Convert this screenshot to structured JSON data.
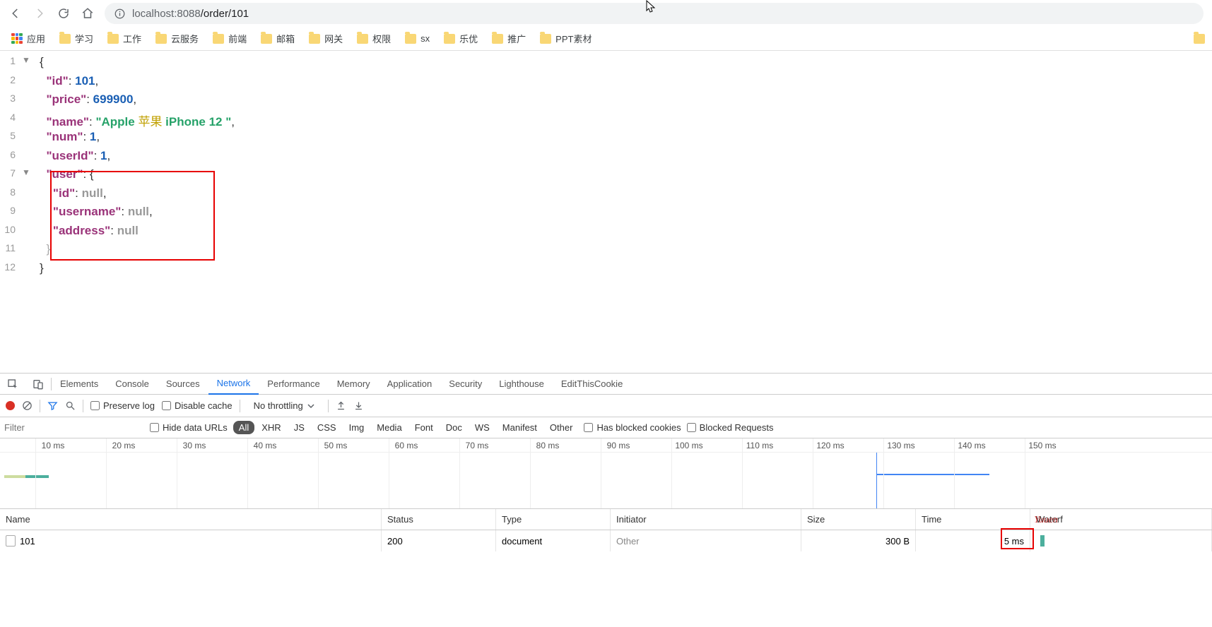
{
  "browser": {
    "url_host": "localhost:8088",
    "url_path": "/order/101"
  },
  "bookmarks": {
    "apps_label": "应用",
    "items": [
      "学习",
      "工作",
      "云服务",
      "前端",
      "邮箱",
      "网关",
      "权限",
      "sx",
      "乐优",
      "推广",
      "PPT素材"
    ]
  },
  "json_lines": [
    {
      "n": "1",
      "fold": "▼",
      "code": [
        {
          "t": "p",
          "v": "{"
        }
      ]
    },
    {
      "n": "2",
      "fold": "",
      "code": [
        {
          "t": "sp",
          "v": "  "
        },
        {
          "t": "k",
          "v": "\"id\""
        },
        {
          "t": "p",
          "v": ": "
        },
        {
          "t": "n",
          "v": "101"
        },
        {
          "t": "p",
          "v": ","
        }
      ]
    },
    {
      "n": "3",
      "fold": "",
      "code": [
        {
          "t": "sp",
          "v": "  "
        },
        {
          "t": "k",
          "v": "\"price\""
        },
        {
          "t": "p",
          "v": ": "
        },
        {
          "t": "n",
          "v": "699900"
        },
        {
          "t": "p",
          "v": ","
        }
      ]
    },
    {
      "n": "4",
      "fold": "",
      "code": [
        {
          "t": "sp",
          "v": "  "
        },
        {
          "t": "k",
          "v": "\"name\""
        },
        {
          "t": "p",
          "v": ": "
        },
        {
          "t": "s",
          "v": "\"Apple "
        },
        {
          "t": "cj",
          "v": "苹果"
        },
        {
          "t": "s",
          "v": " iPhone 12 \""
        },
        {
          "t": "p",
          "v": ","
        }
      ]
    },
    {
      "n": "5",
      "fold": "",
      "code": [
        {
          "t": "sp",
          "v": "  "
        },
        {
          "t": "k",
          "v": "\"num\""
        },
        {
          "t": "p",
          "v": ": "
        },
        {
          "t": "n",
          "v": "1"
        },
        {
          "t": "p",
          "v": ","
        }
      ]
    },
    {
      "n": "6",
      "fold": "",
      "code": [
        {
          "t": "sp",
          "v": "  "
        },
        {
          "t": "k",
          "v": "\"userId\""
        },
        {
          "t": "p",
          "v": ": "
        },
        {
          "t": "n",
          "v": "1"
        },
        {
          "t": "p",
          "v": ","
        }
      ]
    },
    {
      "n": "7",
      "fold": "▼",
      "code": [
        {
          "t": "sp",
          "v": "  "
        },
        {
          "t": "k",
          "v": "\"user\""
        },
        {
          "t": "p",
          "v": ": {"
        }
      ]
    },
    {
      "n": "8",
      "fold": "",
      "code": [
        {
          "t": "sp",
          "v": "    "
        },
        {
          "t": "k",
          "v": "\"id\""
        },
        {
          "t": "p",
          "v": ": "
        },
        {
          "t": "null",
          "v": "null"
        },
        {
          "t": "p",
          "v": ","
        }
      ]
    },
    {
      "n": "9",
      "fold": "",
      "code": [
        {
          "t": "sp",
          "v": "    "
        },
        {
          "t": "k",
          "v": "\"username\""
        },
        {
          "t": "p",
          "v": ": "
        },
        {
          "t": "null",
          "v": "null"
        },
        {
          "t": "p",
          "v": ","
        }
      ]
    },
    {
      "n": "10",
      "fold": "",
      "code": [
        {
          "t": "sp",
          "v": "    "
        },
        {
          "t": "k",
          "v": "\"address\""
        },
        {
          "t": "p",
          "v": ": "
        },
        {
          "t": "null",
          "v": "null"
        }
      ]
    },
    {
      "n": "11",
      "fold": "",
      "code": [
        {
          "t": "sp",
          "v": "  "
        },
        {
          "t": "pd",
          "v": "}"
        }
      ]
    },
    {
      "n": "12",
      "fold": "",
      "code": [
        {
          "t": "p",
          "v": "}"
        }
      ]
    }
  ],
  "devtools": {
    "tabs": [
      "Elements",
      "Console",
      "Sources",
      "Network",
      "Performance",
      "Memory",
      "Application",
      "Security",
      "Lighthouse",
      "EditThisCookie"
    ],
    "active_tab": "Network",
    "preserve_log": "Preserve log",
    "disable_cache": "Disable cache",
    "throttling": "No throttling",
    "filter_placeholder": "Filter",
    "hide_data_urls": "Hide data URLs",
    "filter_pills": [
      "All",
      "XHR",
      "JS",
      "CSS",
      "Img",
      "Media",
      "Font",
      "Doc",
      "WS",
      "Manifest",
      "Other"
    ],
    "has_blocked_cookies": "Has blocked cookies",
    "blocked_requests": "Blocked Requests",
    "timeline_ticks": [
      "10 ms",
      "20 ms",
      "30 ms",
      "40 ms",
      "50 ms",
      "60 ms",
      "70 ms",
      "80 ms",
      "90 ms",
      "100 ms",
      "110 ms",
      "120 ms",
      "130 ms",
      "140 ms",
      "150 ms"
    ],
    "columns": {
      "name": "Name",
      "status": "Status",
      "type": "Type",
      "initiator": "Initiator",
      "size": "Size",
      "time": "Time",
      "waterfall": "Waterf"
    },
    "rows": [
      {
        "name": "101",
        "status": "200",
        "type": "document",
        "initiator": "Other",
        "size": "300 B",
        "time": "5 ms"
      }
    ]
  },
  "watermark": "Yuuen"
}
